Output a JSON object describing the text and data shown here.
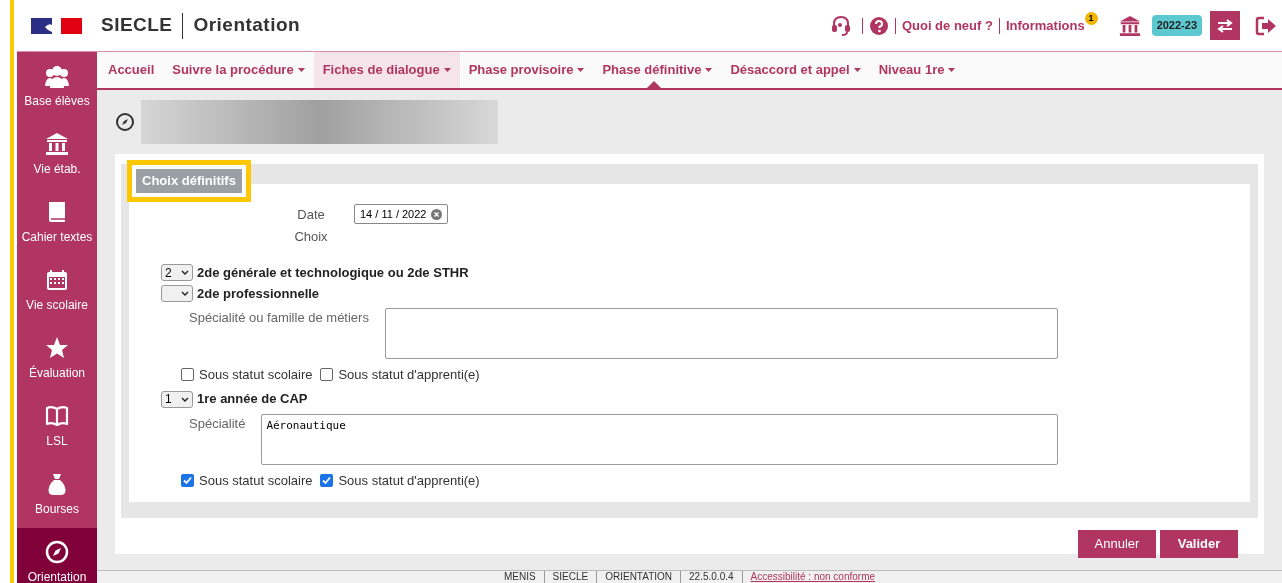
{
  "header": {
    "brand": "SIECLE",
    "app_title": "Orientation",
    "links": [
      {
        "label": "Quoi de neuf ?"
      },
      {
        "label": "Informations",
        "badge": "1"
      }
    ],
    "year_badge": "2022-23"
  },
  "sidebar": {
    "items": [
      {
        "label": "Base élèves",
        "selected": false
      },
      {
        "label": "Vie étab.",
        "selected": false
      },
      {
        "label": "Cahier textes",
        "selected": false
      },
      {
        "label": "Vie scolaire",
        "selected": false
      },
      {
        "label": "Évaluation",
        "selected": false
      },
      {
        "label": "LSL",
        "selected": false
      },
      {
        "label": "Bourses",
        "selected": false
      },
      {
        "label": "Orientation",
        "selected": true
      }
    ]
  },
  "nav": {
    "items": [
      {
        "label": "Accueil",
        "dropdown": false,
        "selected": false,
        "hovered": false
      },
      {
        "label": "Suivre la procédure",
        "dropdown": true,
        "selected": false,
        "hovered": false
      },
      {
        "label": "Fiches de dialogue",
        "dropdown": true,
        "selected": false,
        "hovered": true
      },
      {
        "label": "Phase provisoire",
        "dropdown": true,
        "selected": false,
        "hovered": false
      },
      {
        "label": "Phase définitive",
        "dropdown": true,
        "selected": true,
        "hovered": false
      },
      {
        "label": "Désaccord et appel",
        "dropdown": true,
        "selected": false,
        "hovered": false
      },
      {
        "label": "Niveau 1re",
        "dropdown": true,
        "selected": false,
        "hovered": false
      }
    ]
  },
  "section": {
    "legend": "Choix définitifs",
    "highlighted": true,
    "date_label": "Date Choix",
    "date_value": "14 / 11 / 2022"
  },
  "choices": [
    {
      "kind": "plain",
      "rank": "2",
      "label": "2de générale et technologique ou 2de STHR"
    },
    {
      "kind": "detailed",
      "label": "2de professionnelle",
      "field_label": "Spécialité ou famille de métiers",
      "options": [
        {
          "label": "Sous statut scolaire",
          "checked": false
        },
        {
          "label": "Sous statut d'apprenti(e)",
          "checked": false
        }
      ]
    },
    {
      "kind": "detailed",
      "rank": "1",
      "label": "1re année de CAP",
      "field_label": "Spécialité",
      "field_value": "Aéronautique",
      "options": [
        {
          "label": "Sous statut scolaire",
          "checked": true
        },
        {
          "label": "Sous statut d'apprenti(e)",
          "checked": true
        }
      ]
    }
  ],
  "buttons": [
    {
      "label": "Annuler",
      "kind": "secondary"
    },
    {
      "label": "Valider",
      "kind": "primary"
    }
  ],
  "footer": {
    "items": [
      "MENIS",
      "SIECLE",
      "ORIENTATION",
      "22.5.0.0.4"
    ],
    "accessibility": "Accessibilité : non conforme"
  }
}
